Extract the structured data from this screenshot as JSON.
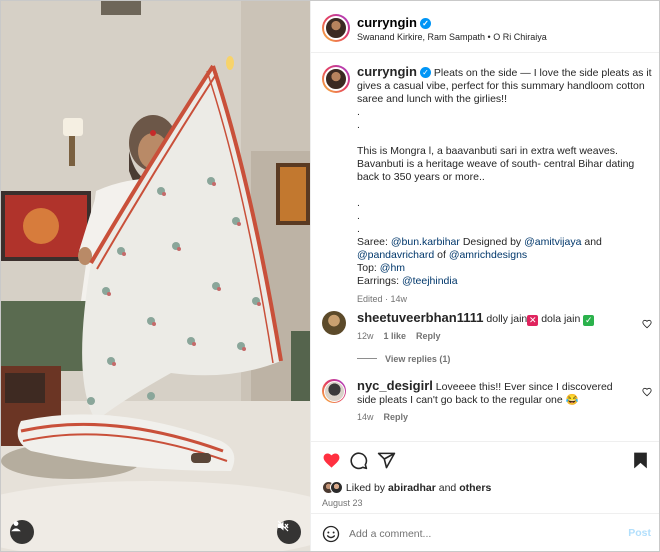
{
  "post": {
    "username": "curryngin",
    "audio": "Swanand Kirkire, Ram Sampath • O Ri Chiraiya",
    "caption_lines": [
      "Pleats on the side — I love the side pleats as it gives a casual vibe, perfect for this summary handloom cotton saree and lunch with the girlies!!",
      ".",
      ".",
      "",
      "This is Mongra l, a baavanbuti sari in extra weft weaves. Bavanbuti is a heritage weave of south- central Bihar dating back to 350 years or more..",
      "",
      ".",
      ".",
      "."
    ],
    "credits": {
      "saree_label": "Saree:",
      "saree_tag": "@bun.karbihar",
      "designed_by": "Designed by",
      "designer1": "@amitvijaya",
      "and": "and",
      "designer2": "@pandavrichard",
      "of": "of",
      "brand": "@amrichdesigns",
      "top_label": "Top:",
      "top_tag": "@hm",
      "earrings_label": "Earrings:",
      "earrings_tag": "@teejhindia"
    },
    "edited": "Edited",
    "age": "14w"
  },
  "comments": [
    {
      "username": "sheetuveerbhan1111",
      "text": "dolly jain",
      "text2": "dola jain",
      "age": "12w",
      "likes": "1 like",
      "reply": "Reply",
      "view_replies": "View replies (1)"
    },
    {
      "username": "nyc_desigirl",
      "text": "Loveeee this!! Ever since I discovered side pleats I can't go back to the regular one",
      "emoji": "😂",
      "age": "14w",
      "reply": "Reply"
    }
  ],
  "likes": {
    "prefix": "Liked by",
    "user": "abiradhar",
    "and": "and",
    "others": "others"
  },
  "date": "August 23",
  "add_comment": {
    "placeholder": "Add a comment...",
    "post_label": "Post"
  },
  "colors": {
    "like_red": "#ff3040",
    "verified_blue": "#0095f6",
    "link_blue": "#00376b",
    "post_disabled": "#b2dffc"
  },
  "icons": [
    "user-tag-icon",
    "mute-icon",
    "heart-icon",
    "comment-icon",
    "share-icon",
    "save-icon",
    "emoji-icon"
  ]
}
